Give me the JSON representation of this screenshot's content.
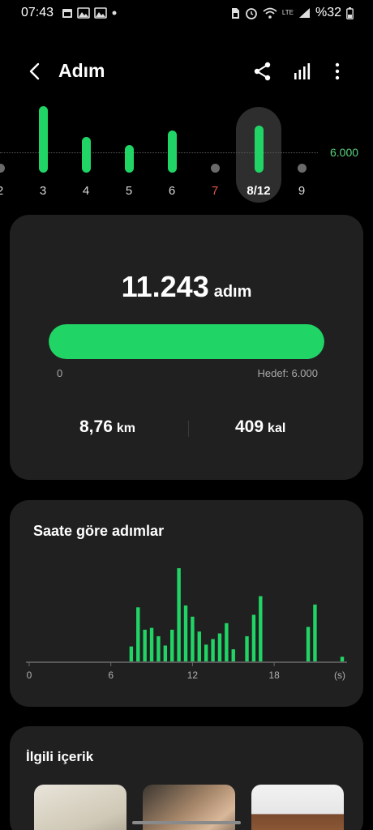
{
  "status_bar": {
    "time": "07:43",
    "battery": "%32",
    "network": "LTE"
  },
  "app_bar": {
    "title": "Adım",
    "icons": [
      "back-arrow-icon",
      "share-icon",
      "chart-icon",
      "more-vertical-icon"
    ]
  },
  "week": {
    "goal_label": "6.000",
    "days": [
      {
        "label": "2",
        "steps": 0,
        "has_bar": false
      },
      {
        "label": "3",
        "steps": 12700,
        "has_bar": true
      },
      {
        "label": "4",
        "steps": 6800,
        "has_bar": true
      },
      {
        "label": "5",
        "steps": 5200,
        "has_bar": true
      },
      {
        "label": "6",
        "steps": 8000,
        "has_bar": true
      },
      {
        "label": "7",
        "steps": 0,
        "has_bar": false,
        "highlight": "red"
      },
      {
        "label": "8/12",
        "steps": 9000,
        "has_bar": true,
        "selected": true
      },
      {
        "label": "9",
        "steps": 0,
        "has_bar": false
      }
    ]
  },
  "summary": {
    "steps_value": "11.243",
    "steps_unit": "adım",
    "progress_fraction": 1.0,
    "progress_min_label": "0",
    "progress_goal_label": "Hedef: 6.000",
    "distance_value": "8,76",
    "distance_unit": "km",
    "calories_value": "409",
    "calories_unit": "kal"
  },
  "hourly": {
    "title": "Saate göre adımlar"
  },
  "chart_data": {
    "type": "bar",
    "title": "Saate göre adımlar",
    "xlabel": "(s)",
    "ylabel": "",
    "x_ticks": [
      "0",
      "6",
      "12",
      "18",
      "(s)"
    ],
    "xlim": [
      0,
      23
    ],
    "ylim": [
      0,
      100
    ],
    "x": [
      7.5,
      8,
      8.5,
      9,
      9.5,
      10,
      10.5,
      11,
      11.5,
      12,
      12.5,
      13,
      13.5,
      14,
      14.5,
      15,
      16,
      16.5,
      17,
      20.5,
      21,
      23
    ],
    "values": [
      16,
      58,
      34,
      36,
      27,
      17,
      34,
      100,
      60,
      48,
      32,
      18,
      24,
      30,
      41,
      13,
      27,
      50,
      70,
      37,
      61,
      5
    ]
  },
  "related": {
    "title": "İlgili içerik"
  },
  "colors": {
    "accent": "#20d465",
    "card": "#202020",
    "background": "#000000",
    "weekend": "#e2574c"
  }
}
